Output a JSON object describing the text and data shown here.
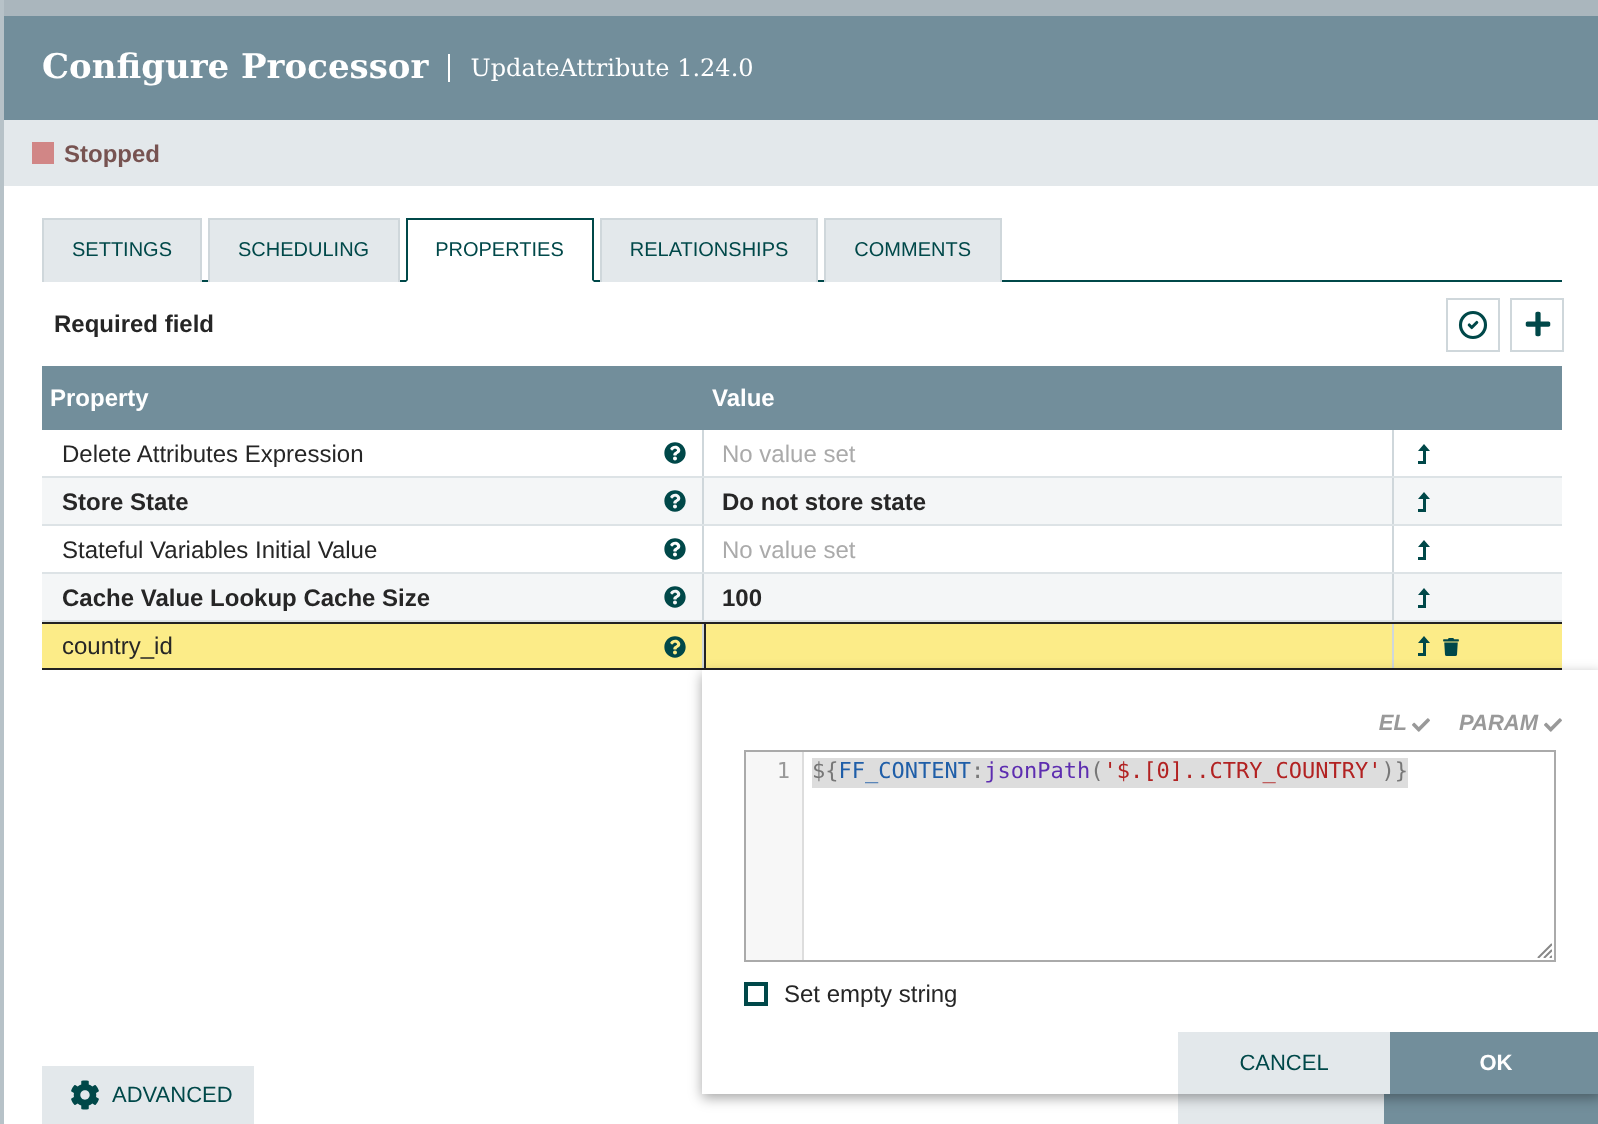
{
  "dialog": {
    "title": "Configure Processor",
    "subtitle": "UpdateAttribute 1.24.0"
  },
  "status": {
    "label": "Stopped",
    "color": "#d18686"
  },
  "tabs": [
    {
      "label": "SETTINGS",
      "selected": false
    },
    {
      "label": "SCHEDULING",
      "selected": false
    },
    {
      "label": "PROPERTIES",
      "selected": true
    },
    {
      "label": "RELATIONSHIPS",
      "selected": false
    },
    {
      "label": "COMMENTS",
      "selected": false
    }
  ],
  "required_note": "Required field",
  "table": {
    "columns": [
      "Property",
      "Value"
    ],
    "rows": [
      {
        "name": "Delete Attributes Expression",
        "required": false,
        "placeholder": "No value set",
        "selected": false,
        "deletable": false
      },
      {
        "name": "Store State",
        "required": true,
        "value": "Do not store state",
        "selected": false,
        "deletable": false
      },
      {
        "name": "Stateful Variables Initial Value",
        "required": false,
        "placeholder": "No value set",
        "selected": false,
        "deletable": false
      },
      {
        "name": "Cache Value Lookup Cache Size",
        "required": true,
        "value": "100",
        "selected": false,
        "deletable": false
      },
      {
        "name": "country_id",
        "required": false,
        "selected": true,
        "deletable": true
      }
    ]
  },
  "editor": {
    "flags": [
      "EL",
      "PARAM"
    ],
    "line_number": "1",
    "tokens": [
      {
        "text": "${",
        "kind": "punct"
      },
      {
        "text": "FF_CONTENT",
        "kind": "attr"
      },
      {
        "text": ":",
        "kind": "punct"
      },
      {
        "text": "jsonPath",
        "kind": "func"
      },
      {
        "text": "(",
        "kind": "punct"
      },
      {
        "text": "'$.[0]..CTRY_COUNTRY'",
        "kind": "string"
      },
      {
        "text": ")}",
        "kind": "punct"
      }
    ],
    "empty_string": {
      "label": "Set empty string",
      "checked": false
    },
    "buttons": [
      {
        "label": "CANCEL",
        "kind": "secondary"
      },
      {
        "label": "OK",
        "kind": "primary"
      }
    ]
  },
  "footer": {
    "advanced": "ADVANCED",
    "buttons": [
      {
        "kind": "secondary"
      },
      {
        "kind": "primary"
      }
    ]
  }
}
